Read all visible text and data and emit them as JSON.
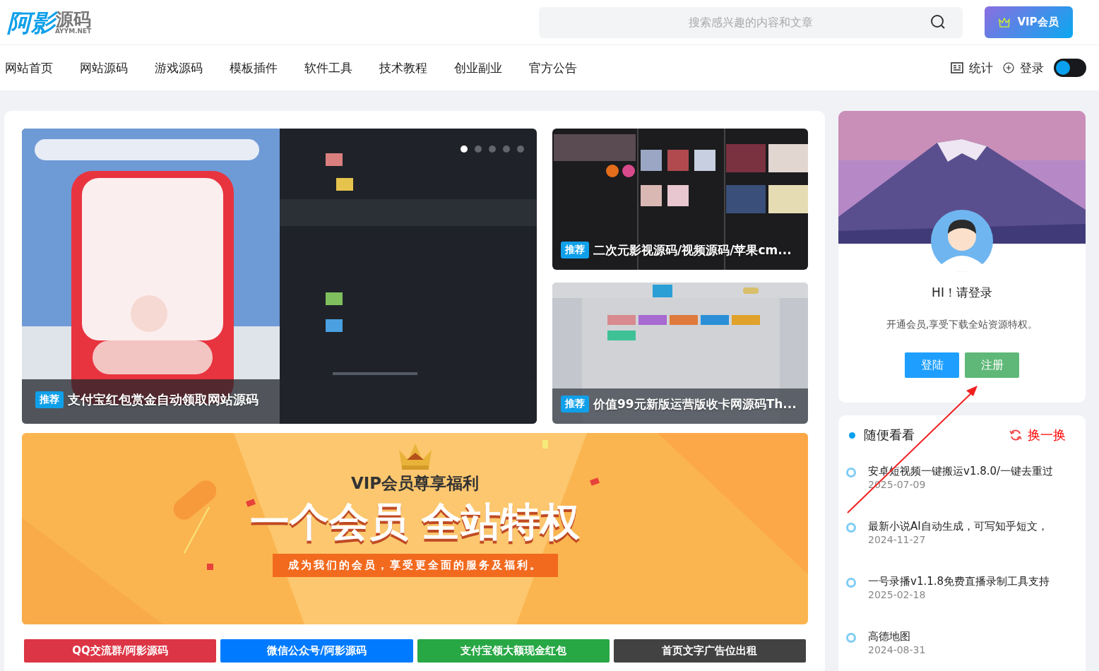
{
  "header": {
    "logo": {
      "main": "阿影",
      "accent": "源码",
      "sub": "AYYM.NET"
    },
    "search": {
      "placeholder": "搜索感兴趣的内容和文章"
    },
    "vip_button": "VIP会员"
  },
  "nav": {
    "items": [
      {
        "label": "网站首页",
        "selected": false
      },
      {
        "label": "网站源码",
        "selected": false
      },
      {
        "label": "游戏源码",
        "selected": false
      },
      {
        "label": "模板插件",
        "selected": false
      },
      {
        "label": "软件工具",
        "selected": false
      },
      {
        "label": "技术教程",
        "selected": false
      },
      {
        "label": "创业副业",
        "selected": false
      },
      {
        "label": "官方公告",
        "selected": false
      }
    ],
    "stats": "统计",
    "login": "登录",
    "theme_toggle": {
      "on": false
    }
  },
  "carousel": {
    "dots": [
      {
        "selected": true
      },
      {
        "selected": false
      },
      {
        "selected": false
      },
      {
        "selected": false
      },
      {
        "selected": false
      }
    ],
    "badge": "推荐",
    "title": "支付宝红包赏金自动领取网站源码"
  },
  "tiles": [
    {
      "kind": "dark",
      "badge": "推荐",
      "title": "二次元影视源码/视频源码/苹果cm..."
    },
    {
      "kind": "light",
      "badge": "推荐",
      "title": "价值99元新版运营版收卡网源码Th..."
    }
  ],
  "vip_banner": {
    "heading": "VIP会员尊享福利",
    "slogan": "一个会员 全站特权",
    "subline": "成为我们的会员，享受更全面的服务及福利。"
  },
  "link_buttons": [
    {
      "label": "QQ交流群/阿影源码",
      "color": "#dc3545"
    },
    {
      "label": "微信公众号/阿影源码",
      "color": "#007bff"
    },
    {
      "label": "支付宝领大额现金红包",
      "color": "#28a745"
    },
    {
      "label": "首页文字广告位出租",
      "color": "#424242"
    }
  ],
  "profile": {
    "greeting": "HI！请登录",
    "note": "开通会员,享受下载全站资源特权。",
    "buttons": [
      {
        "label": "登陆",
        "kind": "login"
      },
      {
        "label": "注册",
        "kind": "register"
      }
    ]
  },
  "random": {
    "title": "随便看看",
    "refresh": "换一换",
    "items": [
      {
        "title": "安卓短视频一键搬运v1.8.0/一键去重过",
        "date": "2025-07-09"
      },
      {
        "title": "最新小说AI自动生成，可写知乎短文，",
        "date": "2024-11-27"
      },
      {
        "title": "一号录播v1.1.8免费直播录制工具支持",
        "date": "2025-02-18"
      },
      {
        "title": "高德地图",
        "date": "2024-08-31"
      }
    ]
  }
}
